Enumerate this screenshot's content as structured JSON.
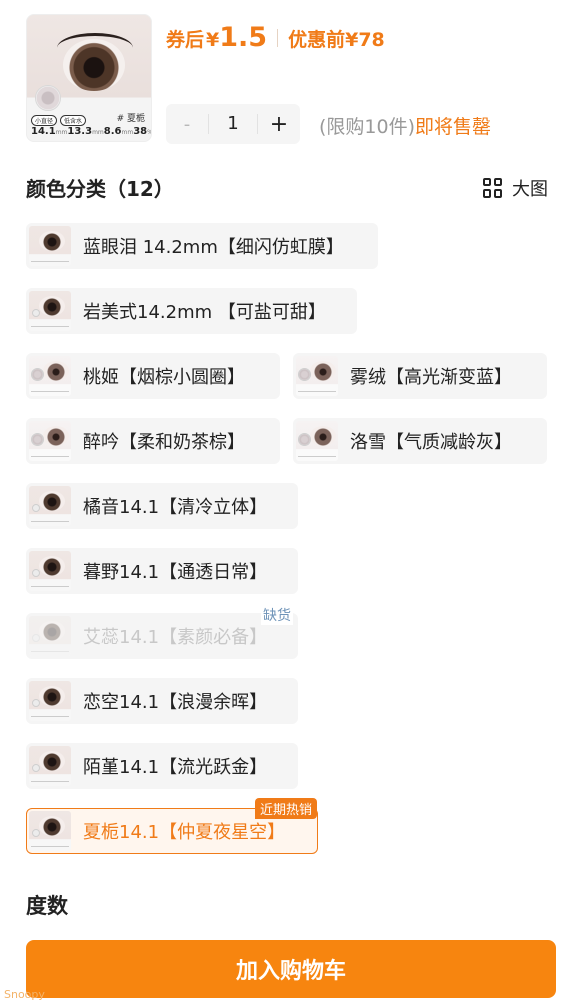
{
  "product": {
    "thumb_variant_tag": "# 夏栀",
    "thumb_mini_tags": [
      "小直径",
      "低含水"
    ],
    "thumb_specs": [
      {
        "value": "14.1",
        "unit": "mm"
      },
      {
        "value": "13.3",
        "unit": "mm"
      },
      {
        "value": "8.6",
        "unit": "mm"
      },
      {
        "value": "38",
        "unit": "%"
      }
    ]
  },
  "price": {
    "after_coupon_label": "券后",
    "currency": "¥",
    "after_coupon_amount": "1.5",
    "before_discount_label": "优惠前",
    "before_discount_amount": "¥78"
  },
  "quantity": {
    "minus": "-",
    "value": "1",
    "plus": "+",
    "limit_text": "(限购10件)",
    "stock_text": "即将售罄"
  },
  "color_section": {
    "title": "颜色分类（12）",
    "big_view_label": "大图",
    "options": [
      {
        "label": "蓝眼泪 14.2mm【细闪仿虹膜】"
      },
      {
        "label": "岩美式14.2mm 【可盐可甜】"
      },
      {
        "label": "桃姬【烟棕小圆圈】"
      },
      {
        "label": "雾绒【高光渐变蓝】"
      },
      {
        "label": "醉吟【柔和奶茶棕】"
      },
      {
        "label": "洛雪【气质减龄灰】"
      },
      {
        "label": "橘音14.1【清冷立体】"
      },
      {
        "label": "暮野14.1【通透日常】"
      },
      {
        "label": "艾蕊14.1【素颜必备】",
        "badge": "缺货",
        "disabled": true
      },
      {
        "label": "恋空14.1【浪漫余晖】"
      },
      {
        "label": "陌堇14.1【流光跃金】"
      },
      {
        "label": "夏栀14.1【仲夏夜星空】",
        "badge": "近期热销",
        "selected": true
      }
    ]
  },
  "degree_section": {
    "title": "度数"
  },
  "cart_button": {
    "label": "加入购物车"
  },
  "watermark": "Snoopy",
  "colors": {
    "accent": "#f07b18",
    "button": "#f7850f",
    "option_bg": "#f5f5f5",
    "oos_badge": "#6e93b8"
  }
}
